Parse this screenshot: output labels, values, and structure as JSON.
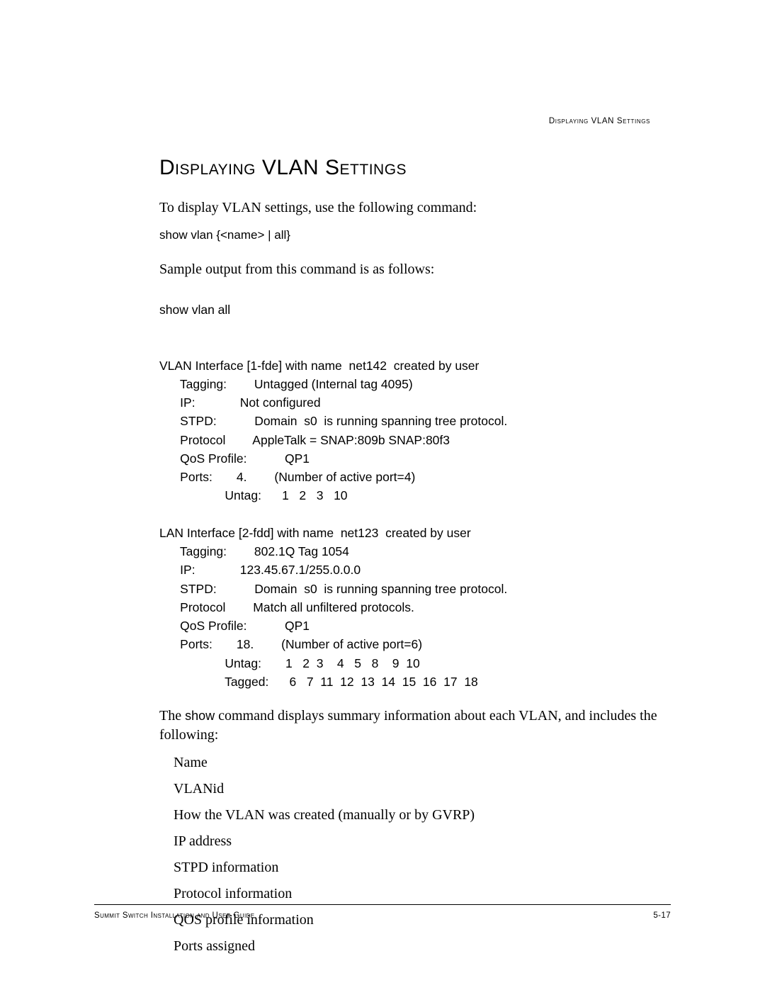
{
  "running_head": "Displaying VLAN Settings",
  "section_title": "Displaying VLAN Settings",
  "intro_para": "To display VLAN settings, use the following command:",
  "command_syntax": "show vlan {<name> | all}",
  "sample_para": "Sample output from this command is as follows:",
  "sample_output": "show vlan all\n\n\nVLAN Interface [1-fde] with name  net142  created by user\n      Tagging:        Untagged (Internal tag 4095)\n      IP:             Not configured\n      STPD:           Domain  s0  is running spanning tree protocol.\n      Protocol        AppleTalk = SNAP:809b SNAP:80f3\n      QoS Profile:           QP1\n      Ports:       4.        (Number of active port=4)\n                   Untag:      1   2   3   10\n\nLAN Interface [2-fdd] with name  net123  created by user\n      Tagging:        802.1Q Tag 1054\n      IP:             123.45.67.1/255.0.0.0\n      STPD:           Domain  s0  is running spanning tree protocol.\n      Protocol        Match all unfiltered protocols.\n      QoS Profile:           QP1\n      Ports:       18.        (Number of active port=6)\n                   Untag:       1   2  3    4   5   8    9  10\n                   Tagged:      6   7  11  12  13  14  15  16  17  18",
  "summary_para_pre": "The ",
  "summary_para_cmd": "show",
  "summary_para_post": " command displays summary information about each VLAN, and includes the following:",
  "bullets": {
    "0": "Name",
    "1": "VLANid",
    "2": "How the VLAN was created (manually or by GVRP)",
    "3": "IP address",
    "4": "STPD information",
    "5": "Protocol information",
    "6": "QOS profile information",
    "7": "Ports assigned"
  },
  "footer_left": "Summit Switch Installation and User Guide",
  "footer_right": "5-17"
}
